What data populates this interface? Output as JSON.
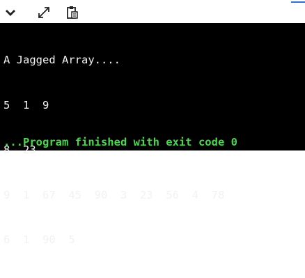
{
  "toolbar": {
    "buttons": [
      {
        "icon": "chevron-down-icon"
      },
      {
        "icon": "expand-icon"
      },
      {
        "icon": "clipboard-icon"
      }
    ],
    "accent_color": "#2f6fd6"
  },
  "terminal": {
    "background": "#000000",
    "text_color": "#f2f2f2",
    "lines": [
      "A Jagged Array....",
      "5  1  9",
      "8  23",
      "9  1  67  45  90  3  23  56  4  78",
      "6  1  90  5"
    ],
    "exit_message": "...Program finished with exit code 0",
    "exit_color": "#47d94a"
  }
}
